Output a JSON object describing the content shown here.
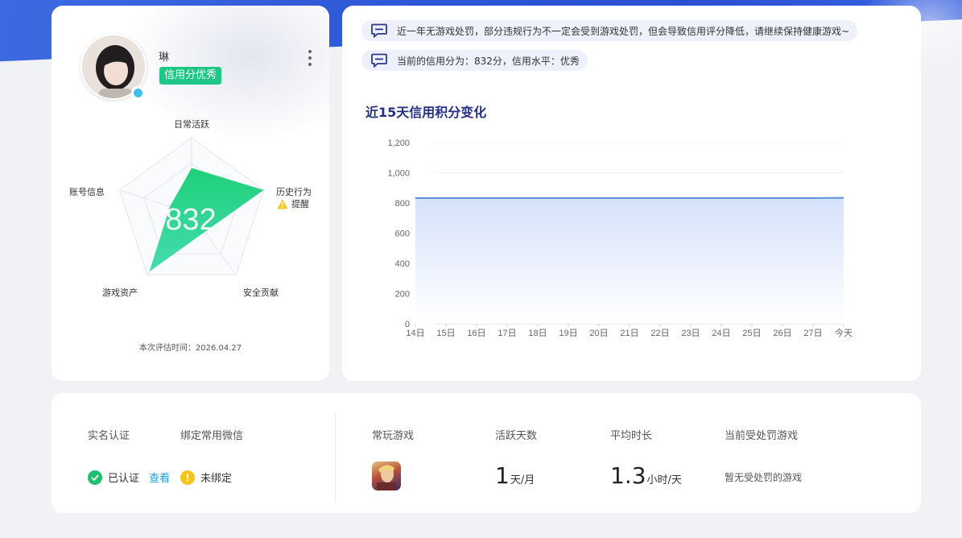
{
  "profile": {
    "username": "琳",
    "credit_badge": "信用分优秀",
    "score": "832",
    "eval_time": "本次评估时间：2026.04.27",
    "radar": {
      "axes": [
        "日常活跃",
        "历史行为",
        "安全贡献",
        "游戏资产",
        "账号信息"
      ],
      "values": [
        0.6,
        1.0,
        0.3,
        0.95,
        0.3
      ],
      "remind_label": "提醒",
      "fill_color_top": "#22c98a",
      "fill_color_bottom": "#37d59a"
    }
  },
  "notices": [
    "近一年无游戏处罚，部分违规行为不一定会受到游戏处罚，但会导致信用评分降低，请继续保持健康游戏~",
    "当前的信用分为：832分，信用水平：优秀"
  ],
  "chart_data": {
    "type": "area",
    "title": "近15天信用积分变化",
    "x": [
      "14日",
      "15日",
      "16日",
      "17日",
      "18日",
      "19日",
      "20日",
      "21日",
      "22日",
      "23日",
      "24日",
      "25日",
      "26日",
      "27日",
      "今天"
    ],
    "y_ticks": [
      "0",
      "200",
      "400",
      "600",
      "800",
      "1,000",
      "1,200"
    ],
    "ylim": [
      0,
      1200
    ],
    "series": [
      {
        "values": [
          832,
          832,
          832,
          832,
          832,
          832,
          832,
          832,
          832,
          832,
          832,
          832,
          832,
          832,
          834
        ]
      }
    ],
    "line_color": "#5b8fd6",
    "grid": true
  },
  "bottom": {
    "real_name_label": "实名认证",
    "wechat_label": "绑定常用微信",
    "verified_text": "已认证",
    "view_link": "查看",
    "unbound_text": "未绑定",
    "frequent_games_label": "常玩游戏",
    "active_days_label": "活跃天数",
    "active_days_value": "1",
    "active_days_unit": "天/月",
    "avg_duration_label": "平均时长",
    "avg_duration_value": "1.3",
    "avg_duration_unit": "小时/天",
    "punished_games_label": "当前受处罚游戏",
    "no_punish_text": "暂无受处罚的游戏"
  }
}
